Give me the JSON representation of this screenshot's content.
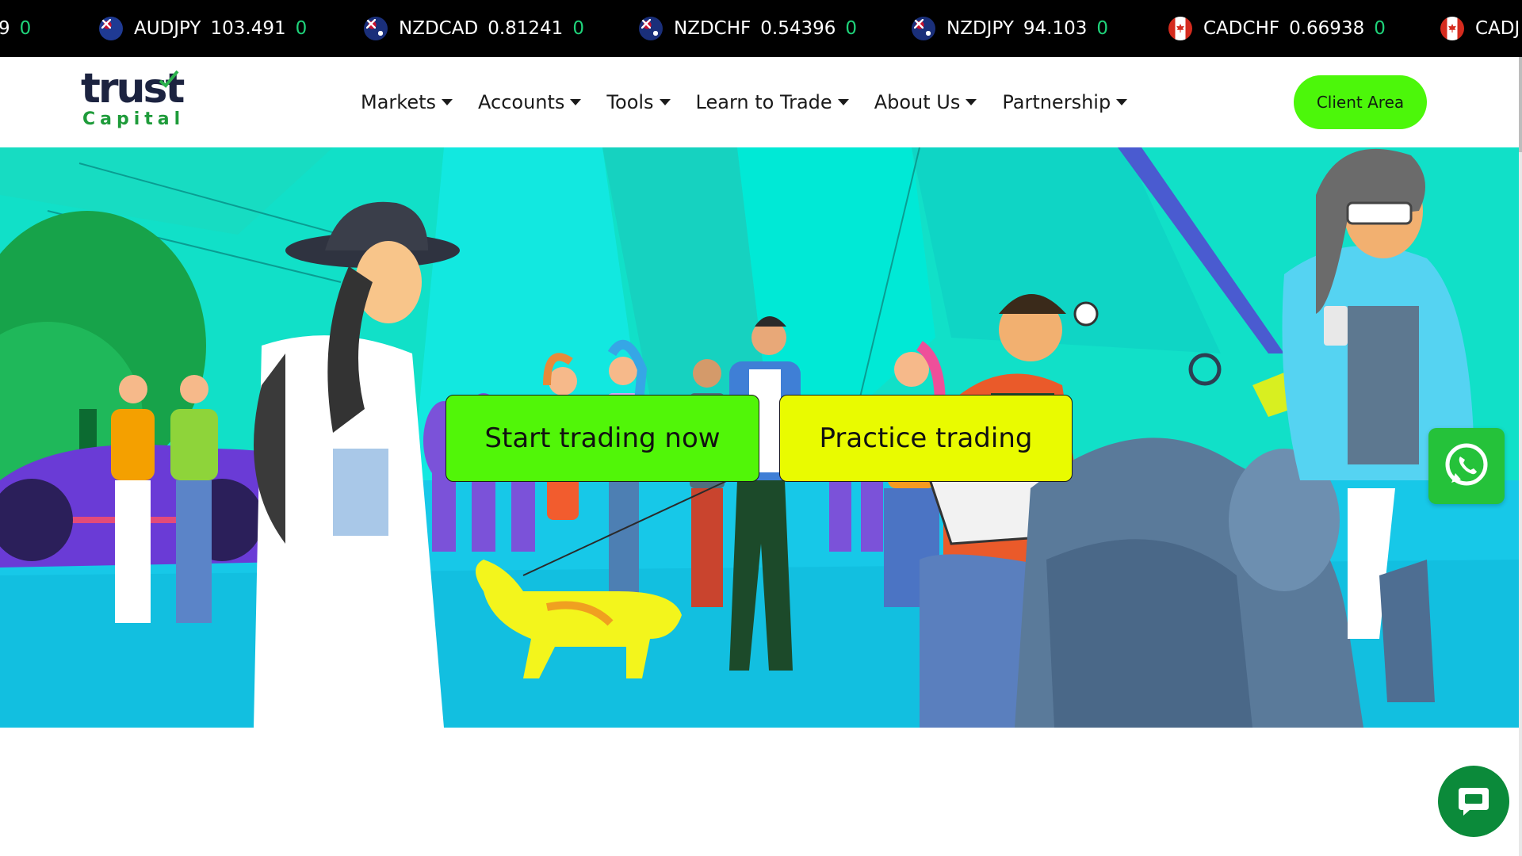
{
  "ticker": [
    {
      "symbol": "",
      "value": "9",
      "change": "0",
      "flag": "none"
    },
    {
      "symbol": "AUDJPY",
      "value": "103.491",
      "change": "0",
      "flag": "au"
    },
    {
      "symbol": "NZDCAD",
      "value": "0.81241",
      "change": "0",
      "flag": "nz"
    },
    {
      "symbol": "NZDCHF",
      "value": "0.54396",
      "change": "0",
      "flag": "nz"
    },
    {
      "symbol": "NZDJPY",
      "value": "94.103",
      "change": "0",
      "flag": "nz"
    },
    {
      "symbol": "CADCHF",
      "value": "0.66938",
      "change": "0",
      "flag": "ca"
    },
    {
      "symbol": "CADJ",
      "value": "",
      "change": "",
      "flag": "ca"
    }
  ],
  "header": {
    "logo_word": "trust",
    "logo_sub": "Capital",
    "nav": [
      "Markets",
      "Accounts",
      "Tools",
      "Learn to Trade",
      "About Us",
      "Partnership"
    ],
    "client_area": "Client Area"
  },
  "hero": {
    "start_label": "Start trading now",
    "practice_label": "Practice trading"
  },
  "icons": {
    "whatsapp": "whatsapp-icon",
    "chat": "chat-icon"
  },
  "colors": {
    "accent_green": "#4cf70a",
    "practice_yellow": "#e9fb00",
    "ticker_change": "#1fd37a"
  }
}
